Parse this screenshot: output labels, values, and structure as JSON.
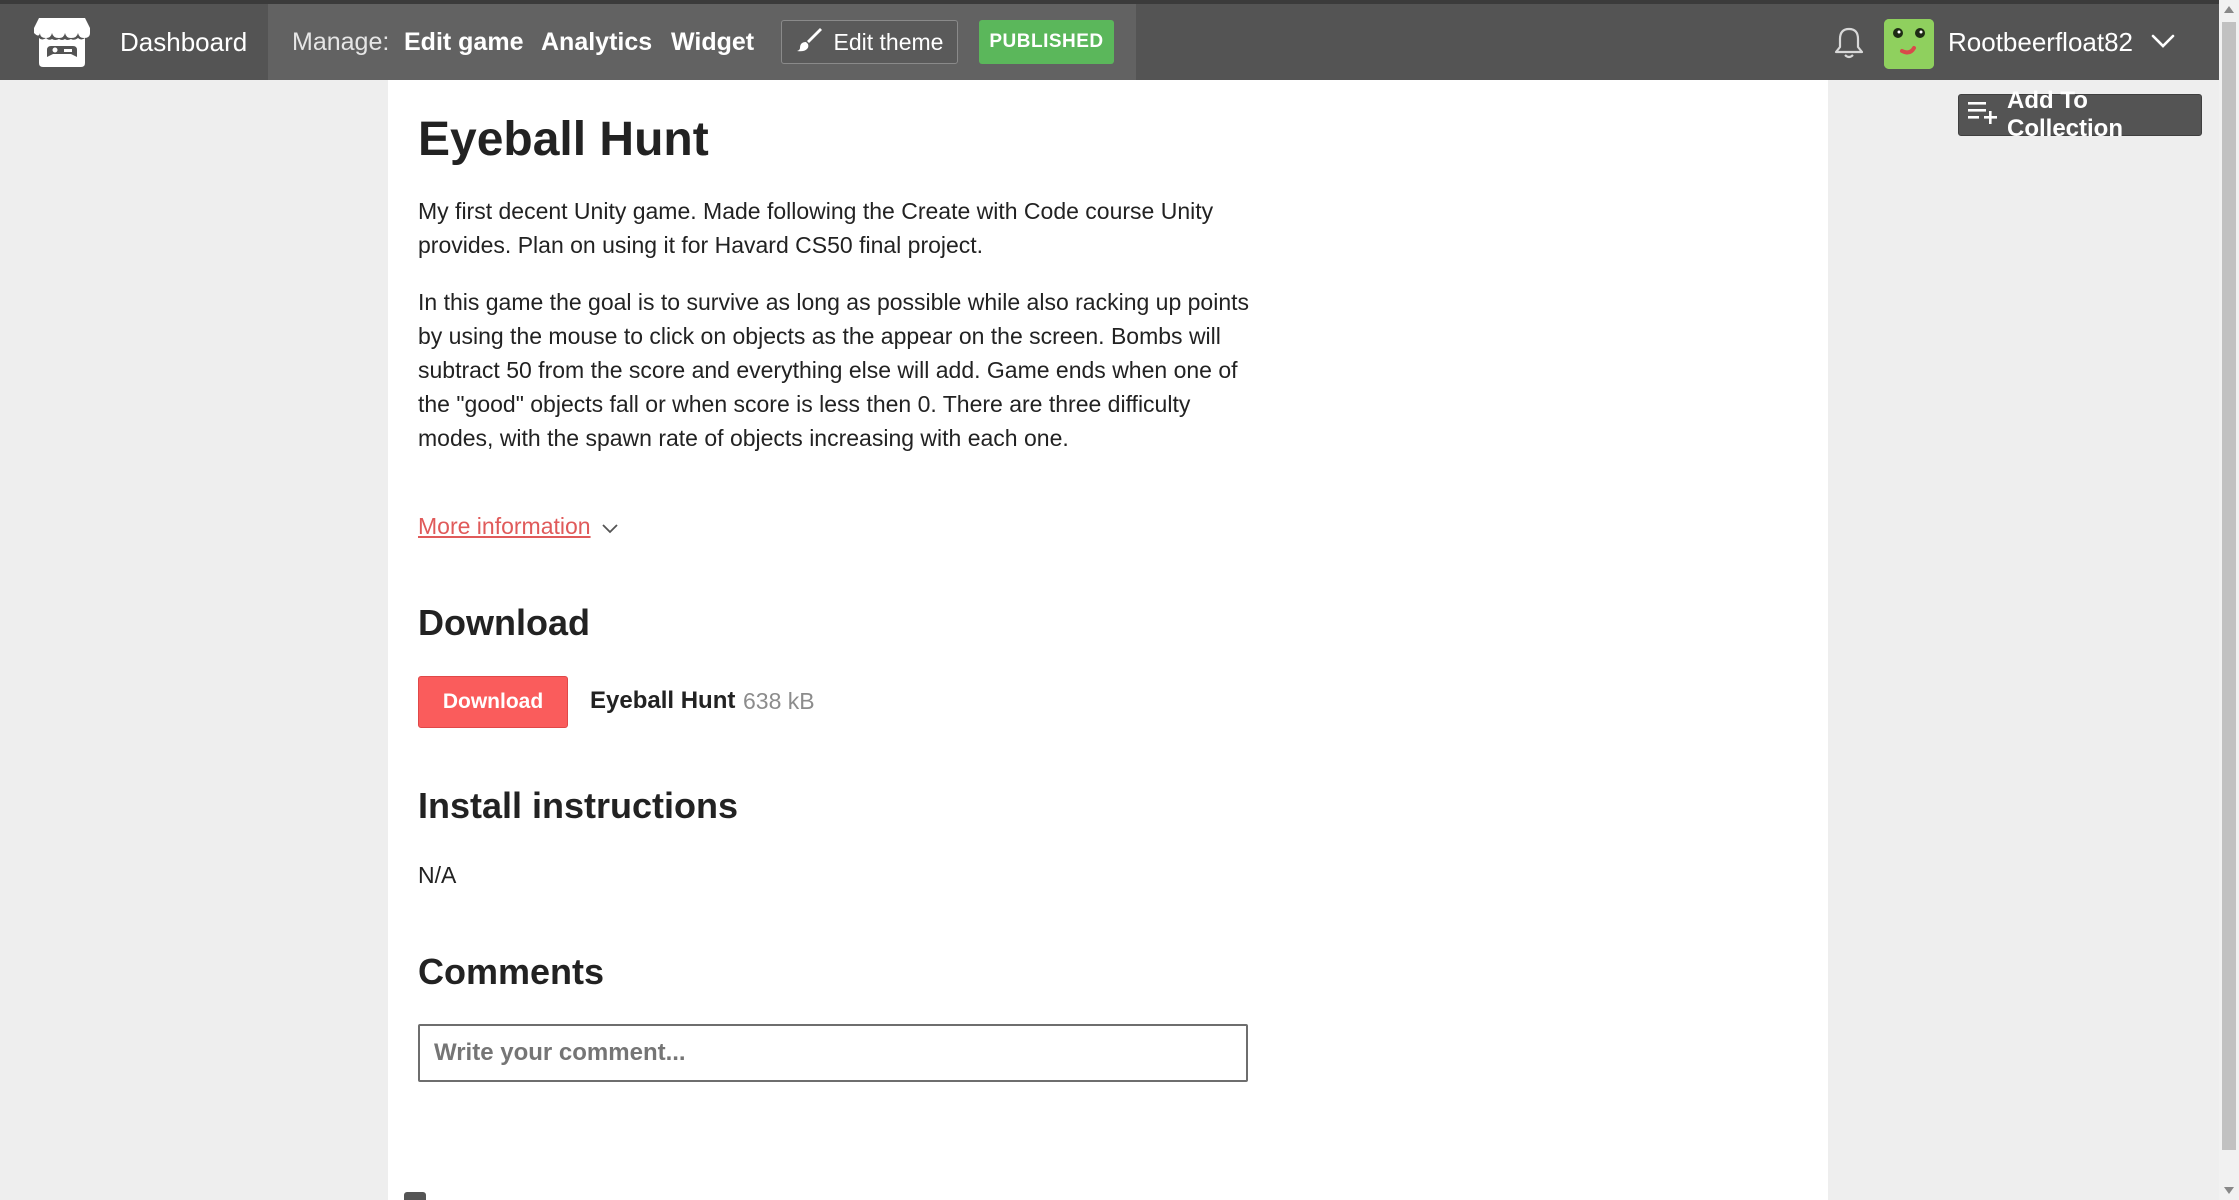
{
  "header": {
    "dashboard_label": "Dashboard",
    "manage_label": "Manage:",
    "nav": [
      "Edit game",
      "Analytics",
      "Widget"
    ],
    "edit_theme_label": "Edit theme",
    "status_badge": "PUBLISHED",
    "username": "Rootbeerfloat82"
  },
  "actions": {
    "add_to_collection": "Add To Collection"
  },
  "game": {
    "title": "Eyeball Hunt",
    "description_paragraphs": [
      "My first decent Unity game. Made following the Create with Code course Unity provides. Plan on using it for Havard CS50 final project.",
      "In this game the goal is to survive as long as possible while also racking up points by using the mouse to click on objects as the appear on the screen. Bombs will subtract 50 from the score and everything else will add. Game ends when one of the \"good\" objects fall or when score is less then 0. There are three difficulty modes, with the spawn rate of objects increasing with each one."
    ],
    "more_information": "More information"
  },
  "download": {
    "heading": "Download",
    "button_label": "Download",
    "file_name": "Eyeball Hunt",
    "file_size": "638 kB"
  },
  "install": {
    "heading": "Install instructions",
    "text": "N/A"
  },
  "comments": {
    "heading": "Comments",
    "placeholder": "Write your comment..."
  },
  "colors": {
    "header_bg": "#545454",
    "manage_bg": "#626262",
    "published_green": "#5bb75b",
    "download_red": "#fa5c5c",
    "link_red": "#e05a5a"
  },
  "icons": {
    "logo": "itch-logo-icon",
    "edit_theme": "paintbrush-icon",
    "notifications": "bell-icon",
    "user_menu": "chevron-down-icon",
    "more_info": "chevron-down-icon",
    "add_collection": "playlist-add-icon"
  }
}
